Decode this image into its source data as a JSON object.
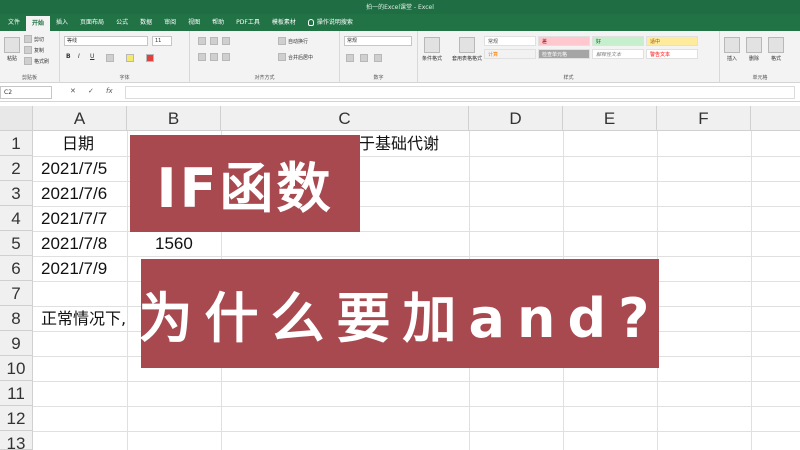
{
  "window": {
    "title": "拍一的Excel课堂 - Excel"
  },
  "tabs": [
    {
      "label": "文件",
      "active": false
    },
    {
      "label": "开始",
      "active": true
    },
    {
      "label": "插入",
      "active": false
    },
    {
      "label": "页面布局",
      "active": false
    },
    {
      "label": "公式",
      "active": false
    },
    {
      "label": "数据",
      "active": false
    },
    {
      "label": "审阅",
      "active": false
    },
    {
      "label": "视图",
      "active": false
    },
    {
      "label": "帮助",
      "active": false
    },
    {
      "label": "PDF工具",
      "active": false
    },
    {
      "label": "模板素材",
      "active": false
    }
  ],
  "tell_me": "操作说明搜索",
  "ribbon": {
    "clipboard": {
      "paste": "粘贴",
      "cut": "剪切",
      "copy": "复制",
      "format_painter": "格式刷",
      "label": "剪贴板"
    },
    "font": {
      "name": "等线",
      "size": "11",
      "label": "字体",
      "bold": "B",
      "italic": "I",
      "underline": "U"
    },
    "alignment": {
      "wrap": "自动换行",
      "merge": "合并后居中",
      "label": "对齐方式"
    },
    "number": {
      "format": "常规",
      "label": "数字"
    },
    "styles": {
      "conditional": "条件格式",
      "table": "套用表格格式",
      "cells": [
        "常规",
        "差",
        "好",
        "适中",
        "计算",
        "检查单元格",
        "解释性文本",
        "警告文本"
      ],
      "label": "样式"
    },
    "cells": {
      "insert": "插入",
      "delete": "删除",
      "format": "格式",
      "label": "单元格"
    }
  },
  "formula_bar": {
    "name_box": "C2",
    "cancel": "✕",
    "enter": "✓",
    "fx": "fx",
    "value": ""
  },
  "grid": {
    "columns": [
      "A",
      "B",
      "C",
      "D",
      "E",
      "F"
    ],
    "rows": [
      "1",
      "2",
      "3",
      "4",
      "5",
      "6",
      "7",
      "8",
      "9",
      "10",
      "11",
      "12",
      "13"
    ],
    "cells": {
      "A1": "日期",
      "C1": "于基础代谢",
      "A2": "2021/7/5",
      "A3": "2021/7/6",
      "A4": "2021/7/7",
      "A5": "2021/7/8",
      "B5": "1560",
      "A6": "2021/7/9",
      "A8": "正常情况下,"
    }
  },
  "overlays": {
    "title": "IF函数",
    "subtitle": "为什么要加and?",
    "color": "#a8484f"
  }
}
